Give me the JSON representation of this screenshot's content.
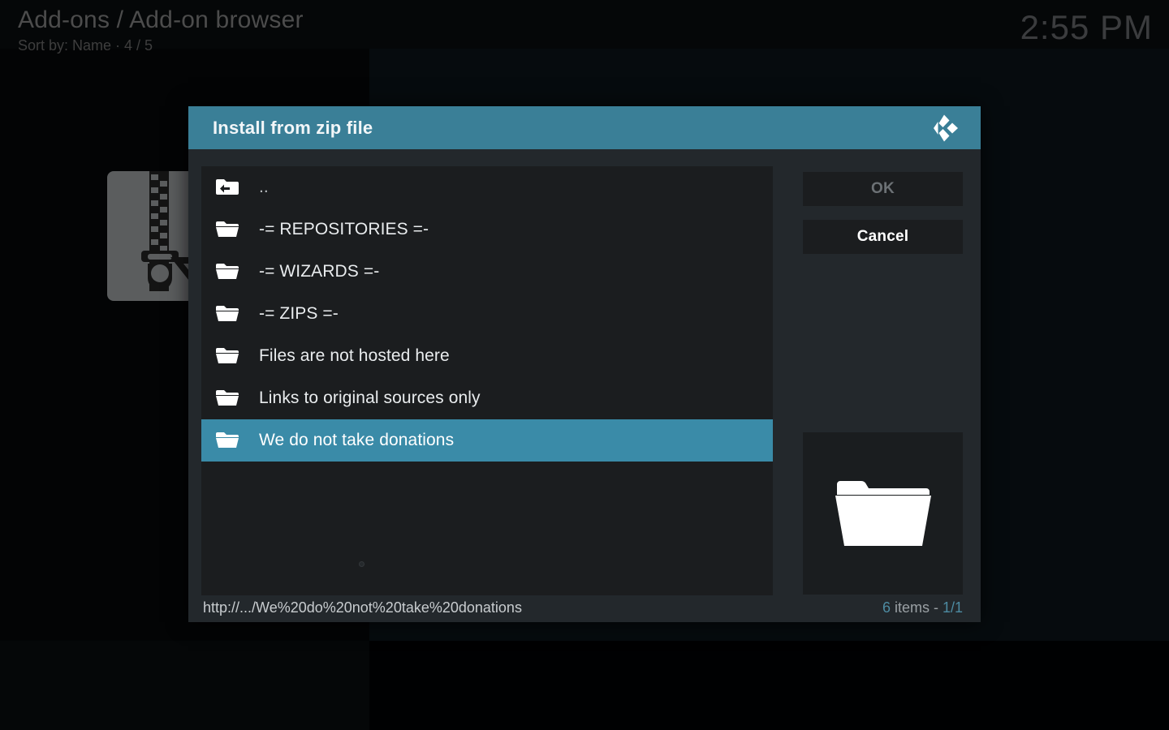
{
  "window": {
    "breadcrumb": "Add-ons / Add-on browser",
    "subtitle": "Sort by: Name  ·  4 / 5",
    "clock": "2:55 PM",
    "background_icon": "zip-download-icon"
  },
  "dialog": {
    "title": "Install from zip file",
    "logo_icon": "kodi-logo-icon",
    "accent_color": "#3a7f97",
    "highlight_color": "#3a8ba8",
    "items": [
      {
        "label": "..",
        "icon": "folder-up-icon",
        "selected": false,
        "dim": true
      },
      {
        "label": "-= REPOSITORIES  =-",
        "icon": "folder-icon",
        "selected": false,
        "dim": false
      },
      {
        "label": "-= WIZARDS =-",
        "icon": "folder-icon",
        "selected": false,
        "dim": false
      },
      {
        "label": "-= ZIPS =-",
        "icon": "folder-icon",
        "selected": false,
        "dim": false
      },
      {
        "label": "Files are not hosted here",
        "icon": "folder-icon",
        "selected": false,
        "dim": false
      },
      {
        "label": "Links to original sources only",
        "icon": "folder-icon",
        "selected": false,
        "dim": false
      },
      {
        "label": "We do not take donations",
        "icon": "folder-icon",
        "selected": true,
        "dim": false
      }
    ],
    "buttons": {
      "ok": "OK",
      "ok_enabled": false,
      "cancel": "Cancel"
    },
    "preview": {
      "icon": "folder-icon"
    },
    "footer": {
      "path": "http://.../We%20do%20not%20take%20donations",
      "count_prefix": "6",
      "count_middle": " items - ",
      "count_page": "1/1"
    }
  }
}
